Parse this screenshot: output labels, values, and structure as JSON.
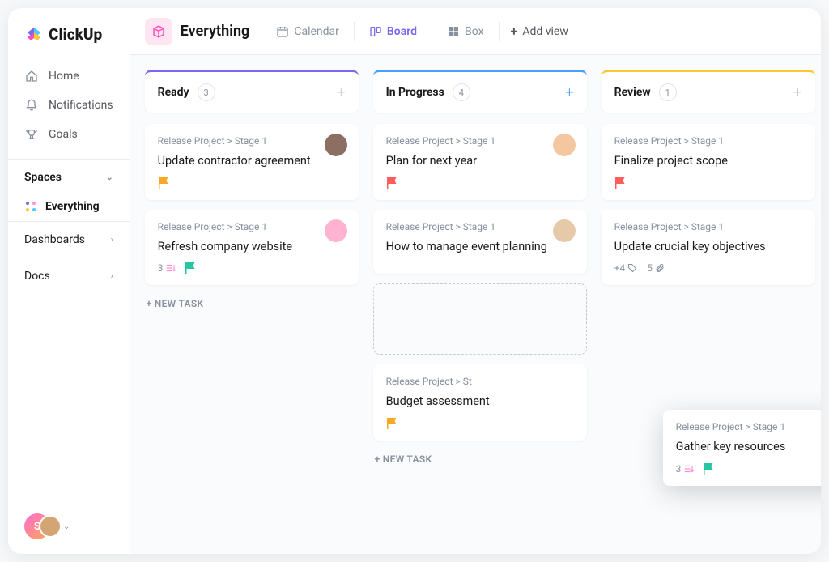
{
  "brand": "ClickUp",
  "sidebar": {
    "nav": [
      {
        "label": "Home"
      },
      {
        "label": "Notifications"
      },
      {
        "label": "Goals"
      }
    ],
    "spaces_label": "Spaces",
    "spaces": [
      {
        "label": "Everything"
      }
    ],
    "sections": [
      {
        "label": "Dashboards"
      },
      {
        "label": "Docs"
      }
    ],
    "user_initial": "S"
  },
  "topbar": {
    "workspace": "Everything",
    "views": [
      {
        "label": "Calendar",
        "active": false
      },
      {
        "label": "Board",
        "active": true
      },
      {
        "label": "Box",
        "active": false
      }
    ],
    "add_view": "Add view"
  },
  "columns": [
    {
      "title": "Ready",
      "count": "3",
      "accent": "#7b68ee",
      "cards": [
        {
          "breadcrumb": "Release Project > Stage 1",
          "title": "Update contractor agreement",
          "flag": "#f9a825",
          "avatar": "#8d6e63"
        },
        {
          "breadcrumb": "Release Project > Stage 1",
          "title": "Refresh company website",
          "flag": "#26c6a4",
          "avatar": "#ffb3d1",
          "subtasks": "3"
        }
      ],
      "new_task": "+ NEW TASK"
    },
    {
      "title": "In Progress",
      "count": "4",
      "accent": "#4a9eff",
      "add_active": true,
      "cards": [
        {
          "breadcrumb": "Release Project > Stage 1",
          "title": "Plan for next year",
          "flag": "#ff5c5c",
          "avatar": "#f4c7a1"
        },
        {
          "breadcrumb": "Release Project > Stage 1",
          "title": "How to manage event planning",
          "avatar": "#e6c9a8"
        }
      ],
      "placeholder": true,
      "extra_cards": [
        {
          "breadcrumb": "Release Project > St",
          "title": "Budget assessment",
          "flag": "#f9a825"
        }
      ],
      "new_task": "+ NEW TASK"
    },
    {
      "title": "Review",
      "count": "1",
      "accent": "#ffc830",
      "cards": [
        {
          "breadcrumb": "Release Project > Stage 1",
          "title": "Finalize project scope",
          "flag": "#ff5c5c"
        },
        {
          "breadcrumb": "Release Project > Stage 1",
          "title": "Update crucial key objectives",
          "tags": "+4",
          "attachments": "5"
        }
      ]
    }
  ],
  "dragging_card": {
    "breadcrumb": "Release Project > Stage 1",
    "title": "Gather key resources",
    "subtasks": "3",
    "flag": "#26c6a4",
    "avatar": "#f0c9a0"
  }
}
